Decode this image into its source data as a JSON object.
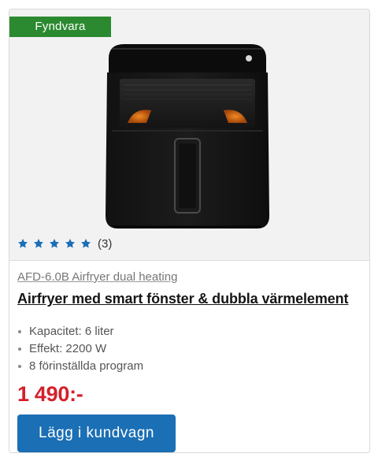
{
  "product": {
    "badge": "Fyndvara",
    "image_icon": "airfryer-product-image",
    "rating": {
      "stars": 5,
      "max_stars": 5,
      "count_label": "(3)"
    },
    "model": "AFD-6.0B Airfryer dual heating",
    "title": "Airfryer med smart fönster & dubbla värmelement",
    "specs": [
      "Kapacitet: 6 liter",
      "Effekt: 2200 W",
      "8 förinställda program"
    ],
    "price": "1 490:-",
    "add_to_cart_label": "Lägg i kundvagn"
  },
  "colors": {
    "badge_green": "#2b8a2f",
    "star_blue": "#1a6fb5",
    "price_red": "#d3212c",
    "button_blue": "#1a6fb5"
  }
}
